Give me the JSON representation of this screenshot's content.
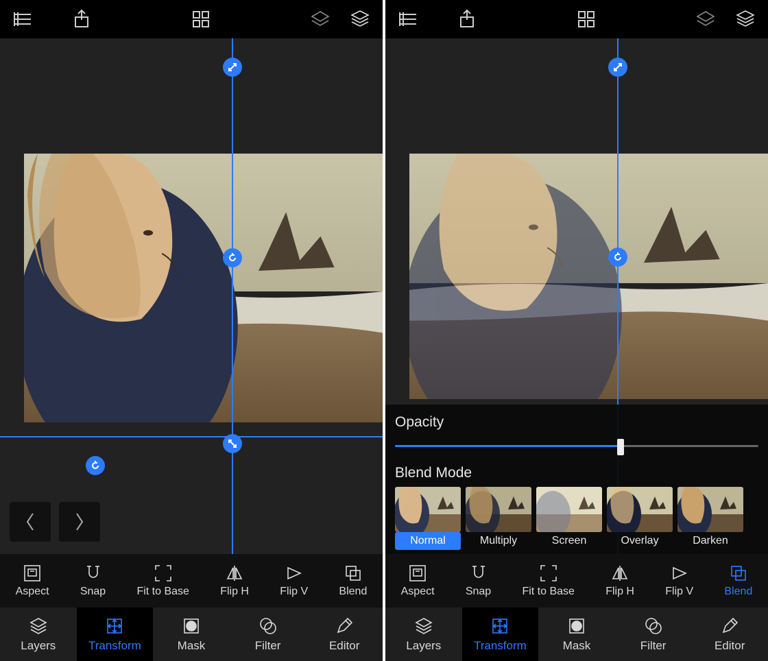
{
  "topbar": {
    "icons": [
      "list-icon",
      "share-icon",
      "grid-icon",
      "layer-outline-icon",
      "layers-icon"
    ]
  },
  "canvas": {
    "selection": true,
    "handles": [
      "scale",
      "rotate",
      "scale",
      "undo"
    ]
  },
  "left": {
    "nav": {
      "prev": "Back",
      "next": "Forward"
    },
    "toolbar": {
      "items": [
        "Aspect",
        "Snap",
        "Fit to Base",
        "Flip H",
        "Flip V",
        "Blend"
      ],
      "active": null
    }
  },
  "right": {
    "blend": {
      "opacity_label": "Opacity",
      "opacity_value": 62,
      "blendmode_label": "Blend Mode",
      "modes": [
        "Normal",
        "Multiply",
        "Screen",
        "Overlay",
        "Darken"
      ],
      "selected": "Normal"
    },
    "toolbar": {
      "items": [
        "Aspect",
        "Snap",
        "Fit to Base",
        "Flip H",
        "Flip V",
        "Blend"
      ],
      "active": "Blend"
    }
  },
  "tabs": {
    "items": [
      "Layers",
      "Transform",
      "Mask",
      "Filter",
      "Editor"
    ],
    "active": "Transform"
  }
}
